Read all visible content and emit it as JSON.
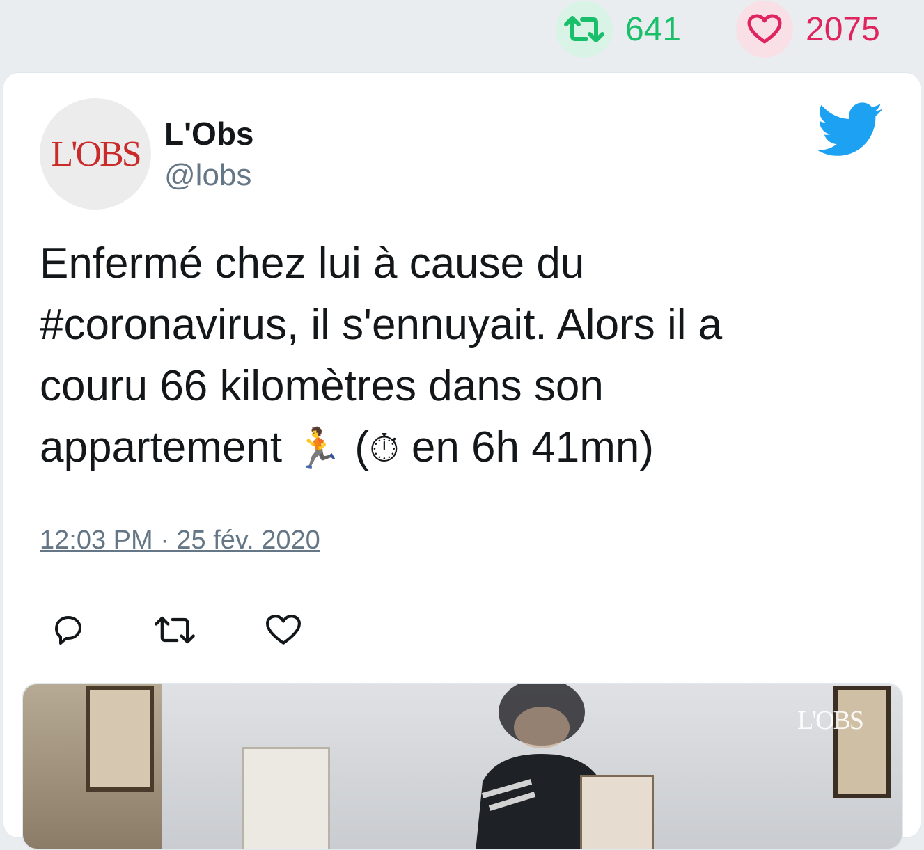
{
  "stats": {
    "retweets": "641",
    "likes": "2075",
    "retweet_color": "#19bf6a",
    "like_color": "#e0245e"
  },
  "tweet": {
    "display_name": "L'Obs",
    "handle": "@lobs",
    "avatar_text": "L'OBS",
    "text_parts": {
      "line1": "Enfermé chez lui à cause du",
      "line2": "#coronavirus, il s'ennuyait. Alors il a",
      "line3": "couru 66 kilomètres dans son",
      "line4_a": "appartement ",
      "runner_emoji": "🏃",
      "line4_b": " (",
      "stopwatch_emoji": "⏱",
      "line4_c": " en 6h 41mn)"
    },
    "timestamp": "12:03 PM · 25 fév. 2020"
  },
  "icons": {
    "retweet": "retweet-icon",
    "like": "heart-icon",
    "reply": "reply-icon",
    "brand": "twitter-bird-icon"
  },
  "media": {
    "watermark": "L'OBS"
  }
}
